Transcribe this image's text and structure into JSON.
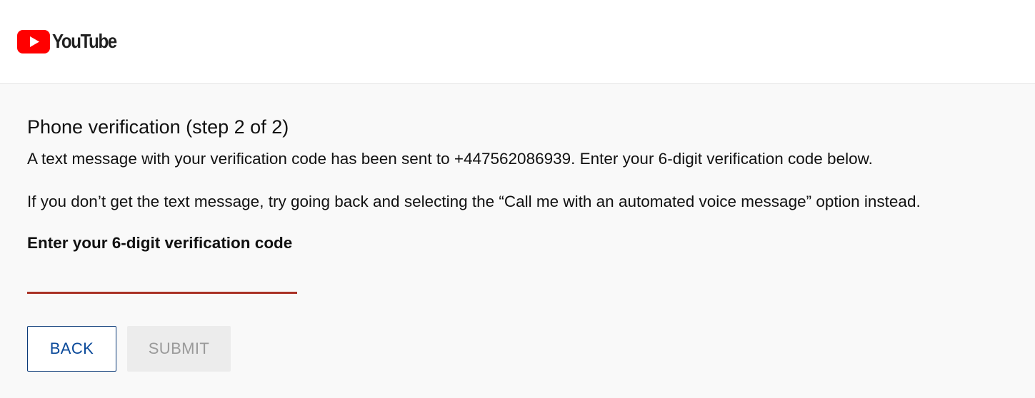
{
  "header": {
    "logo_text": "YouTube",
    "logo_color": "#ff0000",
    "logo_icon": "youtube-play-icon"
  },
  "verification": {
    "title": "Phone verification (step 2 of 2)",
    "message_sent": "A text message with your verification code has been sent to +447562086939. Enter your 6-digit verification code below.",
    "message_fallback": "If you don’t get the text message, try going back and selecting the “Call me with an automated voice message” option instead.",
    "code_label": "Enter your 6-digit verification code",
    "code_value": "",
    "accent_color": "#a93226"
  },
  "buttons": {
    "back_label": "BACK",
    "submit_label": "SUBMIT",
    "back_color": "#0b4a9a",
    "submit_disabled": true
  }
}
